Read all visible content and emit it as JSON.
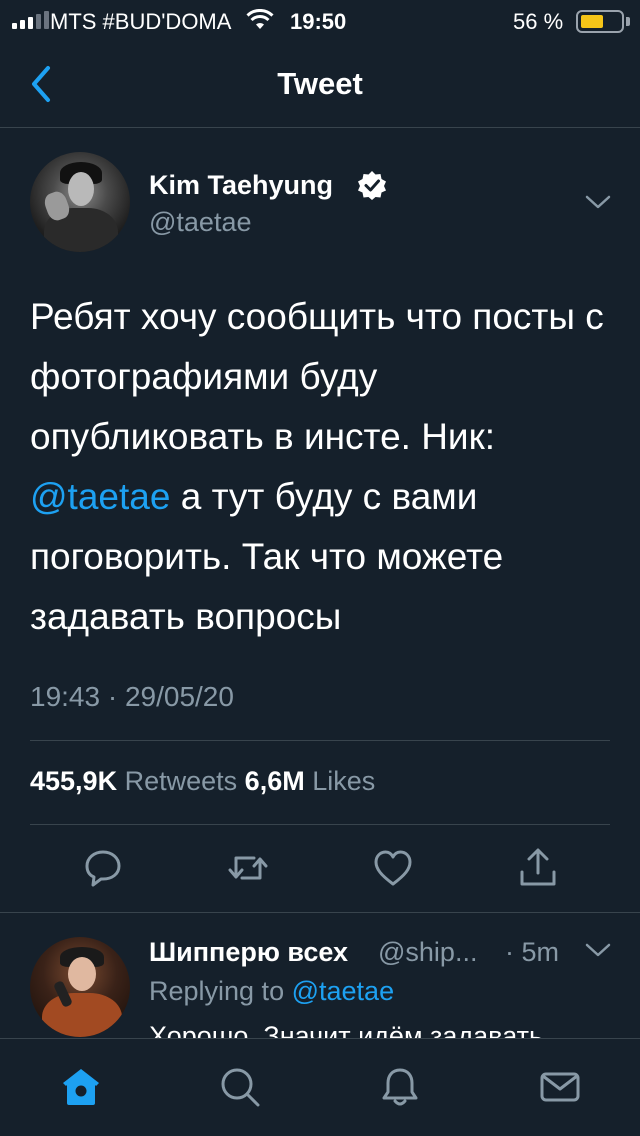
{
  "status_bar": {
    "carrier": "MTS #BUD'DOMA",
    "time": "19:50",
    "battery_percent": "56 %",
    "battery_level": 0.56
  },
  "header": {
    "title": "Tweet"
  },
  "tweet": {
    "author_name": "Kim Taehyung",
    "author_handle": "@taetae",
    "text_part1": "Ребят хочу сообщить что посты с фотографиями буду опубликовать в инсте. Ник: ",
    "text_mention": "@taetae",
    "text_part2": " а тут буду с вами поговорить. Так что можете задавать вопросы",
    "timestamp": "19:43 · 29/05/20",
    "retweets_count": "455,9K",
    "retweets_label": "Retweets",
    "likes_count": "6,6M",
    "likes_label": "Likes"
  },
  "reply": {
    "author_name": "Шипперю всех",
    "author_handle": "@ship...",
    "time": "· 5m",
    "replying_prefix": "Replying to",
    "replying_mention": "@taetae",
    "text": "Хорошо. Значит идём задавать"
  },
  "icons": {
    "back": "chevron-left-icon",
    "verified": "verified-badge-icon",
    "reply": "comment-icon",
    "retweet": "retweet-icon",
    "like": "heart-icon",
    "share": "share-icon",
    "home": "home-icon",
    "search": "search-icon",
    "notifications": "bell-icon",
    "messages": "mail-icon"
  },
  "colors": {
    "background": "#15202b",
    "accent": "#1da1f2",
    "secondary_text": "#8899a6",
    "divider": "#38444d",
    "battery": "#f5c518"
  }
}
